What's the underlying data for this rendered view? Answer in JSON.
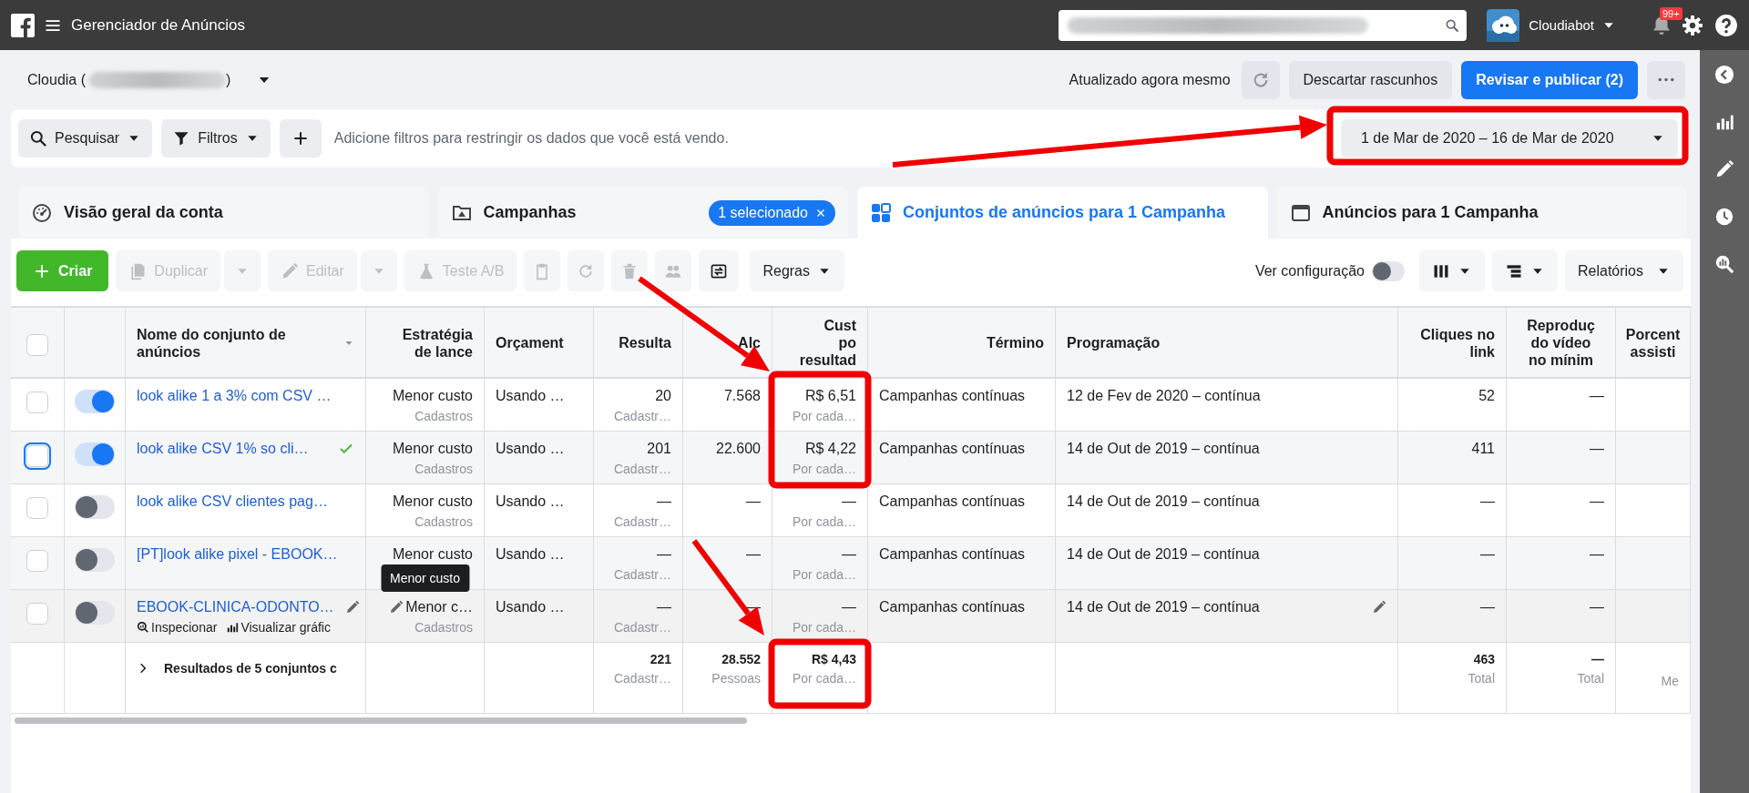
{
  "top_bar": {
    "title": "Gerenciador de Anúncios",
    "user": "Cloudiabot",
    "notifications": "99+"
  },
  "account": {
    "name_start": "Cloudia (",
    "name_end": ")"
  },
  "status": "Atualizado agora mesmo",
  "header_buttons": [
    {
      "kind": "secondary",
      "label": "Descartar rascunhos"
    },
    {
      "kind": "primary",
      "label": "Revisar e publicar (2)"
    }
  ],
  "filter_bar": {
    "buttons": [
      {
        "label": "Pesquisar"
      },
      {
        "label": "Filtros"
      }
    ],
    "placeholder": "Adicione filtros para restringir os dados que você está vendo.",
    "date_range": "1 de Mar de 2020 – 16 de Mar de 2020"
  },
  "tabs": [
    {
      "label": "Visão geral da conta",
      "selected": false
    },
    {
      "label": "Campanhas",
      "selected": false,
      "badge": "1 selecionado"
    },
    {
      "label": "Conjuntos de anúncios para 1 Campanha",
      "selected": true
    },
    {
      "label": "Anúncios para 1 Campanha",
      "selected": false
    }
  ],
  "toolbar": {
    "items": [
      {
        "kind": "primary",
        "label": "Criar",
        "disabled": false
      },
      {
        "kind": "split",
        "label": "Duplicar",
        "disabled": true
      },
      {
        "kind": "split",
        "label": "Editar",
        "disabled": true
      },
      {
        "kind": "text",
        "label": "Teste A/B",
        "disabled": true
      },
      {
        "kind": "icon",
        "disabled": true
      },
      {
        "kind": "icon",
        "disabled": true
      },
      {
        "kind": "icon",
        "disabled": true
      },
      {
        "kind": "icon",
        "disabled": true
      },
      {
        "kind": "icon",
        "disabled": false
      },
      {
        "kind": "menu",
        "label": "Regras",
        "disabled": false
      }
    ],
    "view_setting": {
      "label": "Ver configuração",
      "on": false
    },
    "right_items": [
      {
        "kind": "icon-menu"
      },
      {
        "kind": "icon-menu"
      },
      {
        "kind": "menu",
        "label": "Relatórios"
      }
    ]
  },
  "table": {
    "columns": [
      {
        "kind": "checkbox",
        "checked": false
      },
      {
        "kind": "toggle"
      },
      {
        "kind": "name",
        "label": "Nome do conjunto de anúncios"
      },
      {
        "kind": "text",
        "label": "Estratégia\nde lance"
      },
      {
        "kind": "text",
        "label": "Orçament"
      },
      {
        "kind": "text",
        "label": "Resulta"
      },
      {
        "kind": "text",
        "label": "Alc"
      },
      {
        "kind": "text",
        "label": "Cust\npo\nresultad"
      },
      {
        "kind": "text",
        "label": "Término"
      },
      {
        "kind": "text",
        "label": "Programação"
      },
      {
        "kind": "text",
        "label": "Cliques no\nlink"
      },
      {
        "kind": "text",
        "label": "Reproduç\ndo vídeo\nno mínim"
      },
      {
        "kind": "text",
        "label": "Porcent\nassisti"
      }
    ],
    "rows": [
      {
        "hovered": false,
        "cells": [
          {
            "checked": false
          },
          {
            "on": true
          },
          {
            "text": "look alike 1 a 3% com CSV …"
          },
          {
            "text": "Menor custo",
            "sub": "Cadastros"
          },
          {
            "text": "Usando …"
          },
          {
            "text": "20",
            "sub": "Cadastr…"
          },
          {
            "text": "7.568"
          },
          {
            "text": "R$ 6,51",
            "sub": "Por cada…"
          },
          {
            "text": "Campanhas contínuas"
          },
          {
            "text": "12 de Fev de 2020 – contínua"
          },
          {
            "text": "52"
          },
          {
            "text": "—"
          },
          {}
        ]
      },
      {
        "hovered": false,
        "cells": [
          {
            "checked": false,
            "focused": true
          },
          {
            "on": true
          },
          {
            "text": "look alike CSV 1% so cli…",
            "check_mark": true
          },
          {
            "text": "Menor custo",
            "sub": "Cadastros"
          },
          {
            "text": "Usando …"
          },
          {
            "text": "201",
            "sub": "Cadastr…"
          },
          {
            "text": "22.600"
          },
          {
            "text": "R$ 4,22",
            "sub": "Por cada…"
          },
          {
            "text": "Campanhas contínuas"
          },
          {
            "text": "14 de Out de 2019 – contínua"
          },
          {
            "text": "411"
          },
          {
            "text": "—"
          },
          {}
        ]
      },
      {
        "hovered": false,
        "cells": [
          {
            "checked": false
          },
          {
            "on": false
          },
          {
            "text": "look alike CSV clientes pag…"
          },
          {
            "text": "Menor custo",
            "sub": "Cadastros"
          },
          {
            "text": "Usando …"
          },
          {
            "text": "—",
            "sub": "Cadastr…"
          },
          {
            "text": "—"
          },
          {
            "text": "—",
            "sub": "Por cada…"
          },
          {
            "text": "Campanhas contínuas"
          },
          {
            "text": "14 de Out de 2019 – contínua"
          },
          {
            "text": "—"
          },
          {
            "text": "—"
          },
          {}
        ]
      },
      {
        "hovered": false,
        "cells": [
          {
            "checked": false
          },
          {
            "on": false
          },
          {
            "text": "[PT]look alike pixel - EBOOK…"
          },
          {
            "text": "Menor custo",
            "tooltip": "Menor custo"
          },
          {
            "text": "Usando …"
          },
          {
            "text": "—",
            "sub": "Cadastr…"
          },
          {
            "text": "—"
          },
          {
            "text": "—",
            "sub": "Por cada…"
          },
          {
            "text": "Campanhas contínuas"
          },
          {
            "text": "14 de Out de 2019 – contínua"
          },
          {
            "text": "—"
          },
          {
            "text": "—"
          },
          {}
        ]
      },
      {
        "hovered": true,
        "cells": [
          {
            "checked": false
          },
          {
            "on": false
          },
          {
            "text": "EBOOK-CLINICA-ODONTO…",
            "links": [
              "Inspecionar",
              "Visualizar gráfic"
            ]
          },
          {
            "text": "Menor c…",
            "sub": "Cadastros"
          },
          {
            "text": "Usando …"
          },
          {
            "text": "—",
            "sub": "Cadastr…"
          },
          {
            "text": "—"
          },
          {
            "text": "—",
            "sub": "Por cada…"
          },
          {
            "text": "Campanhas contínuas"
          },
          {
            "text": "14 de Out de 2019 – contínua"
          },
          {
            "text": "—"
          },
          {
            "text": "—"
          },
          {}
        ]
      }
    ],
    "totals": {
      "cells": [
        {},
        {},
        {
          "text": "Resultados de 5 conjuntos c"
        },
        {},
        {},
        {
          "text": "221",
          "sub": "Cadastr…"
        },
        {
          "text": "28.552",
          "sub": "Pessoas"
        },
        {
          "text": "R$ 4,43",
          "sub": "Por cada…"
        },
        {},
        {},
        {
          "text": "463",
          "sub": "Total"
        },
        {
          "text": "—",
          "sub": "Total"
        },
        {
          "sub": "Me"
        }
      ]
    }
  },
  "annotations": [
    {
      "kind": "frame"
    },
    {
      "kind": "arrow"
    },
    {
      "kind": "frame"
    },
    {
      "kind": "arrow"
    },
    {
      "kind": "frame"
    },
    {
      "kind": "arrow"
    }
  ]
}
